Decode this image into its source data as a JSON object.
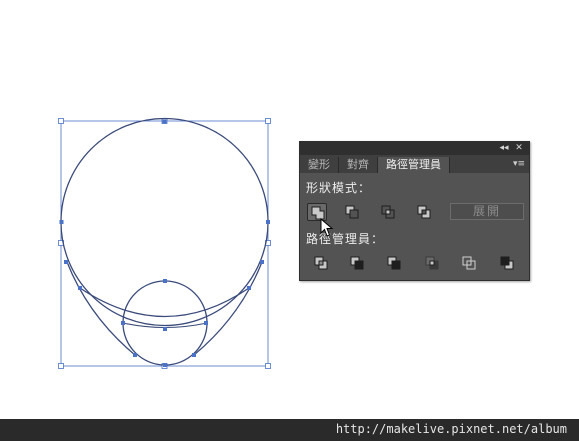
{
  "panel": {
    "titlebar": {
      "collapse_glyph": "◂◂",
      "close_glyph": "✕"
    },
    "tabs": [
      {
        "label": "變形",
        "active": false
      },
      {
        "label": "對齊",
        "active": false
      },
      {
        "label": "路徑管理員",
        "active": true
      }
    ],
    "menu_glyph": "▾≡",
    "shape_modes_label": "形狀模式：",
    "shape_modes": [
      {
        "name": "unite-icon",
        "pressed": true
      },
      {
        "name": "minus-front-icon",
        "pressed": false
      },
      {
        "name": "intersect-icon",
        "pressed": false
      },
      {
        "name": "exclude-icon",
        "pressed": false
      }
    ],
    "expand_label": "展開",
    "pathfinders_label": "路徑管理員：",
    "pathfinders": [
      {
        "name": "divide-icon"
      },
      {
        "name": "trim-icon"
      },
      {
        "name": "merge-icon"
      },
      {
        "name": "crop-icon"
      },
      {
        "name": "outline-icon"
      },
      {
        "name": "minus-back-icon"
      }
    ]
  },
  "footer": {
    "watermark": "http://makelive.pixnet.net/album"
  },
  "colors": {
    "selection": "#4a72c8",
    "path": "#3a4a7a",
    "panel_bg": "#535353",
    "titlebar_bg": "#2f2f2f"
  }
}
